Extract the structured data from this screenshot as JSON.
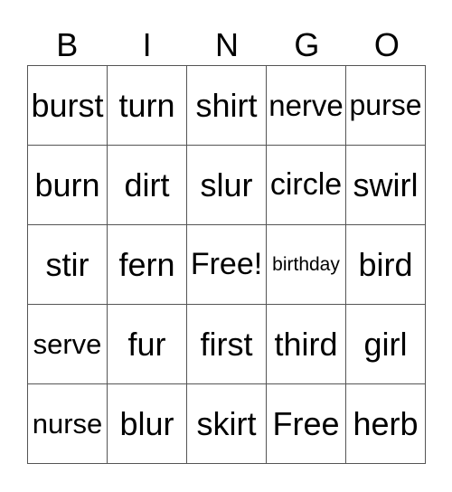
{
  "header": [
    "B",
    "I",
    "N",
    "G",
    "O"
  ],
  "rows": [
    [
      "burst",
      "turn",
      "shirt",
      "nerve",
      "purse"
    ],
    [
      "burn",
      "dirt",
      "slur",
      "circle",
      "swirl"
    ],
    [
      "stir",
      "fern",
      "Free!",
      "birthday",
      "bird"
    ],
    [
      "serve",
      "fur",
      "first",
      "third",
      "girl"
    ],
    [
      "nurse",
      "blur",
      "skirt",
      "Free",
      "herb"
    ]
  ]
}
